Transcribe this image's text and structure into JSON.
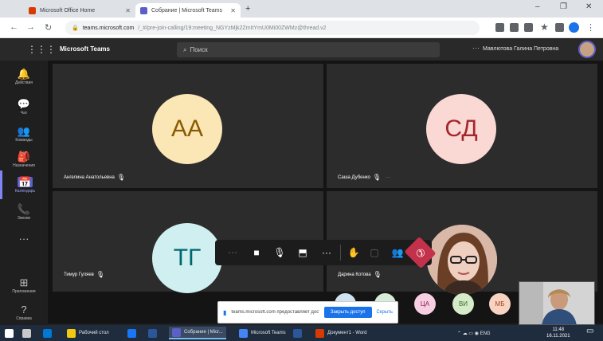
{
  "browser": {
    "tabs": [
      {
        "title": "Microsoft Office Home",
        "favicon_color": "#d83b01",
        "active": false
      },
      {
        "title": "Собрание | Microsoft Teams",
        "favicon_color": "#5b5fc7",
        "active": true
      }
    ],
    "new_tab": "+",
    "window_controls": [
      "–",
      "❐",
      "✕"
    ],
    "url_host": "teams.microsoft.com",
    "url_rest": "/_#/pre-join-calling/19:meeting_NGYzMjk2ZmItYmU0Mi00ZWMz@thread.v2",
    "extension_colors": [
      "#5f6368",
      "#5f6368",
      "#5f6368",
      "#5f6368",
      "#5f6368",
      "#1a73e8"
    ]
  },
  "teams": {
    "app_name": "Microsoft Teams",
    "search_placeholder": "Поиск",
    "header_more": "···",
    "user_name": "Мавлютова Галина Петровна",
    "rail": [
      {
        "label": "Действия",
        "icon": "bell-icon",
        "glyph": "🔔"
      },
      {
        "label": "Чат",
        "icon": "chat-icon",
        "glyph": "💬"
      },
      {
        "label": "Команды",
        "icon": "teams-icon",
        "glyph": "👥"
      },
      {
        "label": "Назначения",
        "icon": "assignments-icon",
        "glyph": "🎒"
      },
      {
        "label": "Календарь",
        "icon": "calendar-icon",
        "glyph": "📅",
        "active": true
      },
      {
        "label": "Звонки",
        "icon": "phone-icon",
        "glyph": "📞"
      },
      {
        "label": "",
        "icon": "more-apps-icon",
        "glyph": "···"
      },
      {
        "label": "Приложения",
        "icon": "apps-icon",
        "glyph": "⊞"
      },
      {
        "label": "Справка",
        "icon": "help-icon",
        "glyph": "?"
      }
    ]
  },
  "meeting": {
    "participants": [
      {
        "initials": "АА",
        "name": "Ангелина Анатольевна",
        "bg": "#fbe7b5",
        "fg": "#8a5a00"
      },
      {
        "initials": "СД",
        "name": "Саша Дубенко",
        "bg": "#fad8d4",
        "fg": "#a4262c"
      },
      {
        "initials": "ТГ",
        "name": "Тимур Гуляев",
        "bg": "#cfeff0",
        "fg": "#00666d"
      },
      {
        "initials": "",
        "name": "Дарина Котова",
        "bg": "#e8d0c8",
        "fg": "#4a2b20"
      }
    ],
    "tile_more": "···",
    "toolbar": [
      {
        "name": "timer",
        "icon": "clock-icon",
        "glyph": "⋯",
        "disabled": true
      },
      {
        "name": "camera",
        "icon": "camera-icon",
        "glyph": "■"
      },
      {
        "name": "mic",
        "icon": "mic-icon",
        "glyph": "🎙"
      },
      {
        "name": "share",
        "icon": "share-screen-icon",
        "glyph": "⬒"
      },
      {
        "name": "more",
        "icon": "more-actions-icon",
        "glyph": "···"
      },
      {
        "name": "raise-hand",
        "icon": "hand-icon",
        "glyph": "✋"
      },
      {
        "name": "chat",
        "icon": "meeting-chat-icon",
        "glyph": "▢",
        "disabled": true
      },
      {
        "name": "participants",
        "icon": "participants-icon",
        "glyph": "👥"
      }
    ],
    "hangup_glyph": "✆",
    "bubbles": [
      {
        "initials": "",
        "bg": "#cfe2f0",
        "fg": "#1f4e79"
      },
      {
        "initials": "",
        "bg": "#d7ecd7",
        "fg": "#2e6b2e"
      },
      {
        "initials": "ЦА",
        "bg": "#f6cfe2",
        "fg": "#8a1e55"
      },
      {
        "initials": "ВИ",
        "bg": "#d6ecc9",
        "fg": "#3f6b2b"
      },
      {
        "initials": "МБ",
        "bg": "#f9d3c2",
        "fg": "#a0441d"
      }
    ],
    "share_notice": {
      "text": "teams.microsoft.com предоставляет доступ к вашему экрану.",
      "stop": "Закрыть доступ",
      "hide": "Скрыть"
    }
  },
  "taskbar": {
    "items": [
      {
        "label": "",
        "color": "#ffffff",
        "icon": "windows-start-icon"
      },
      {
        "label": "",
        "color": "#c8c8c8",
        "icon": "search-taskbar-icon"
      },
      {
        "label": "",
        "color": "#0078d4",
        "icon": "edge-icon"
      },
      {
        "label": "Рабочий стол",
        "color": "#f2c811",
        "icon": "explorer-icon"
      },
      {
        "label": "",
        "color": "#1877f2",
        "icon": "facebook-icon"
      },
      {
        "label": "",
        "color": "#2b579a",
        "icon": "word-icon"
      },
      {
        "label": "Собрание | Micr...",
        "color": "#5b5fc7",
        "icon": "teams-taskbar-icon",
        "active": true
      },
      {
        "label": "Microsoft Teams",
        "color": "#4285f4",
        "icon": "chrome-icon"
      },
      {
        "label": "",
        "color": "#2b579a",
        "icon": "word2-icon"
      },
      {
        "label": "Документ1 - Word",
        "color": "#d83b01",
        "icon": "office-icon"
      }
    ],
    "tray": "⌃  ☁  ▭  ◉  ENG",
    "time": "11:48",
    "date": "16.11.2021"
  }
}
